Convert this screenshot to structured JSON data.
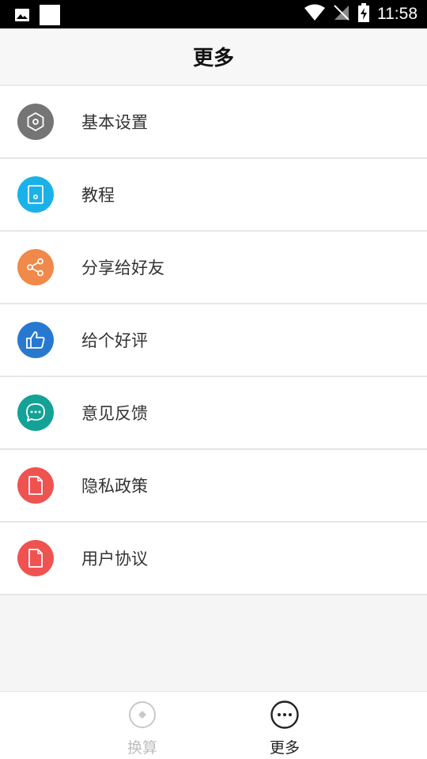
{
  "status_bar": {
    "time": "11:58"
  },
  "header": {
    "title": "更多"
  },
  "menu": {
    "items": [
      {
        "label": "基本设置",
        "icon": "settings-icon",
        "color": "#757575"
      },
      {
        "label": "教程",
        "icon": "tutorial-icon",
        "color": "#1ab1e8"
      },
      {
        "label": "分享给好友",
        "icon": "share-icon",
        "color": "#f0894a"
      },
      {
        "label": "给个好评",
        "icon": "thumbs-up-icon",
        "color": "#2779d0"
      },
      {
        "label": "意见反馈",
        "icon": "feedback-icon",
        "color": "#14a196"
      },
      {
        "label": "隐私政策",
        "icon": "document-icon",
        "color": "#ef5350"
      },
      {
        "label": "用户协议",
        "icon": "document-icon",
        "color": "#ef5350"
      }
    ]
  },
  "tabbar": {
    "tabs": [
      {
        "label": "换算",
        "icon": "convert-icon",
        "active": false
      },
      {
        "label": "更多",
        "icon": "more-icon",
        "active": true
      }
    ]
  },
  "colors": {
    "active_tab": "#222222",
    "inactive_tab": "#bdbdbd",
    "divider": "#e6e6e6"
  }
}
